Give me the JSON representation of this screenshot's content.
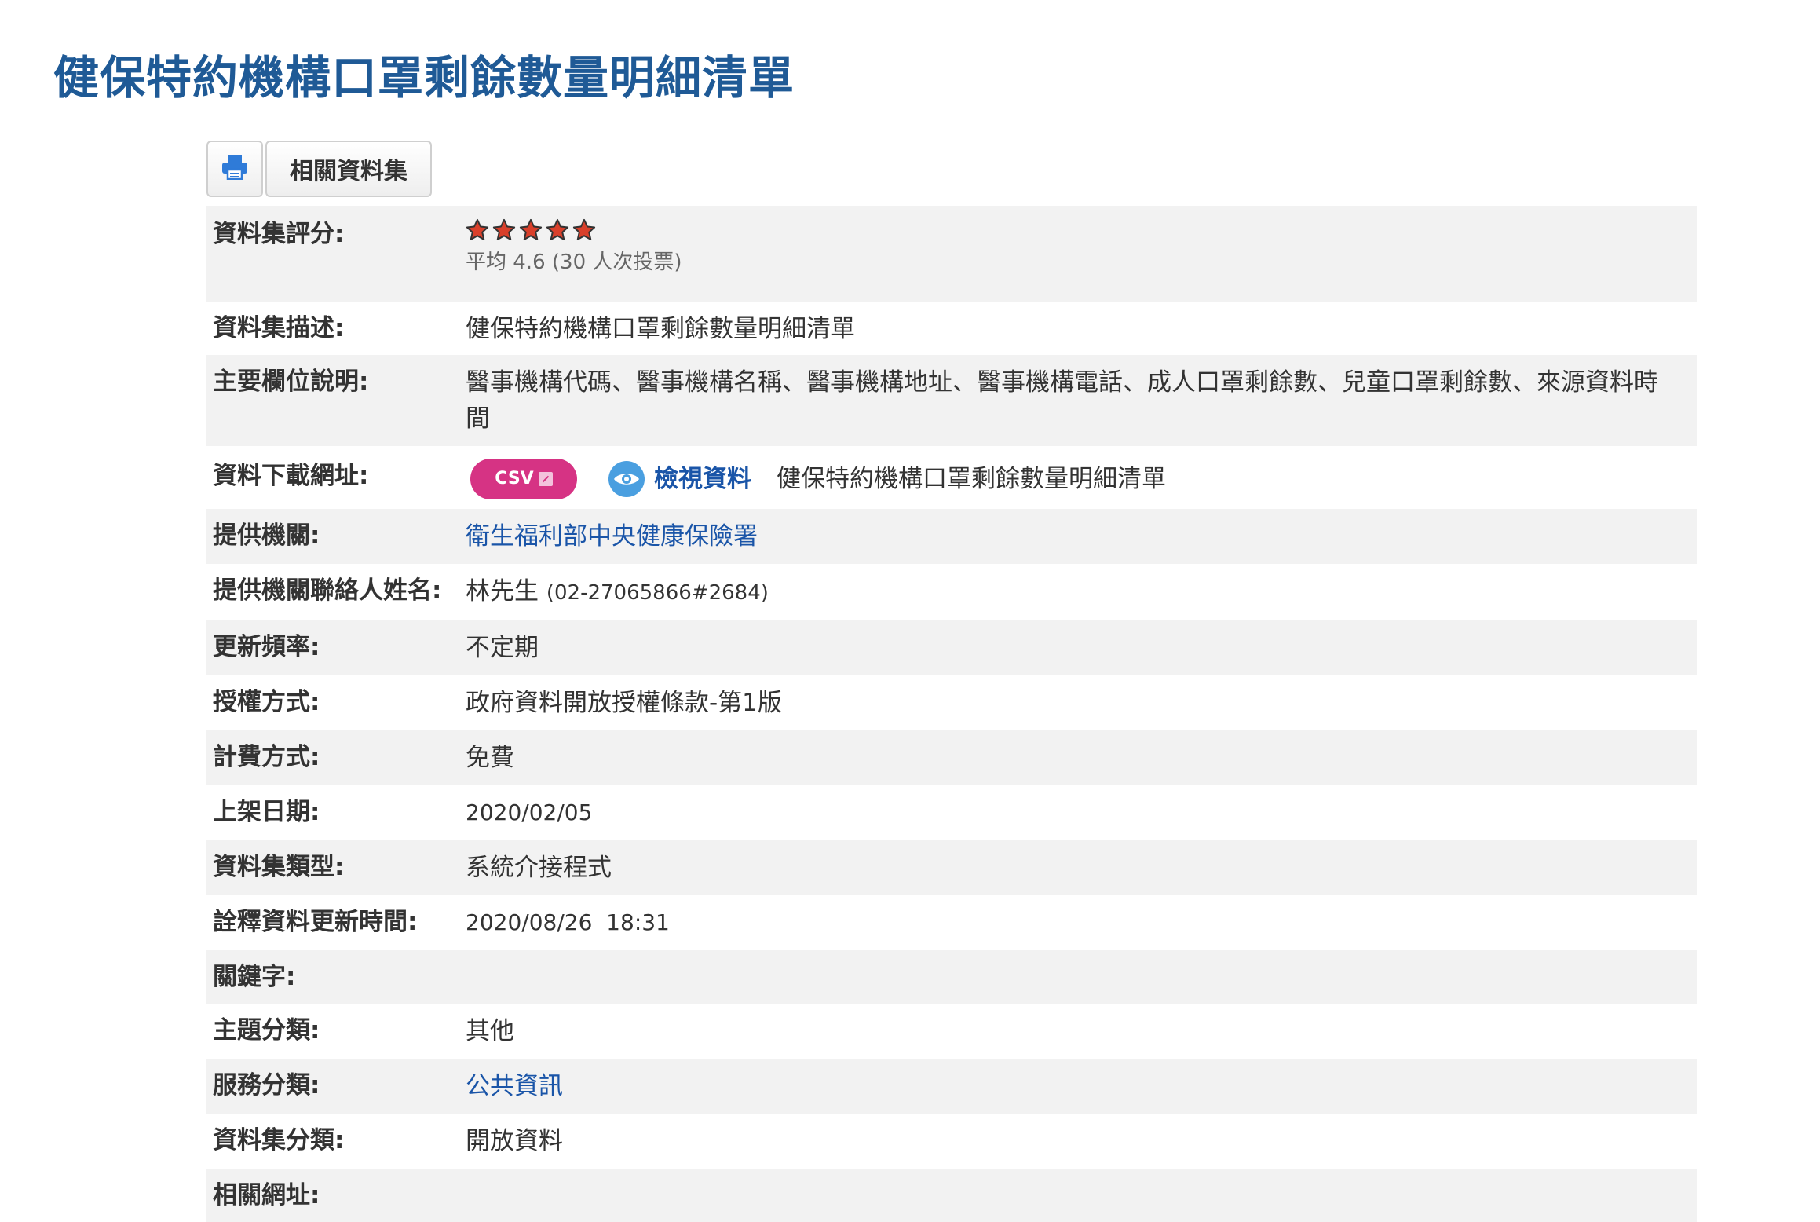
{
  "page": {
    "title": "健保特約機構口罩剩餘數量明細清單"
  },
  "toolbar": {
    "print_icon": "printer-icon",
    "related_label": "相關資料集"
  },
  "colors": {
    "title": "#1f5a96",
    "link": "#1a55a8",
    "csv_badge": "#d63384",
    "eye_icon": "#4a9fe0",
    "star": "#d9402b",
    "row_shade": "#f2f2f2"
  },
  "rating": {
    "label": "資料集評分:",
    "stars": 5,
    "average_text": "平均 4.6 (30 人次投票)"
  },
  "description": {
    "label": "資料集描述:",
    "value": "健保特約機構口罩剩餘數量明細清單"
  },
  "fields": {
    "label": "主要欄位說明:",
    "value": "醫事機構代碼、醫事機構名稱、醫事機構地址、醫事機構電話、成人口罩剩餘數、兒童口罩剩餘數、來源資料時間"
  },
  "download": {
    "label": "資料下載網址:",
    "csv_label": "CSV",
    "view_label": "檢視資料",
    "name": "健保特約機構口罩剩餘數量明細清單"
  },
  "provider": {
    "label": "提供機關:",
    "value": "衛生福利部中央健康保險署"
  },
  "contact": {
    "label": "提供機關聯絡人姓名:",
    "name": "林先生",
    "phone": "(02-27065866#2684)"
  },
  "frequency": {
    "label": "更新頻率:",
    "value": "不定期"
  },
  "license": {
    "label": "授權方式:",
    "value": "政府資料開放授權條款-第1版"
  },
  "fee": {
    "label": "計費方式:",
    "value": "免費"
  },
  "published": {
    "label": "上架日期:",
    "value": "2020/02/05"
  },
  "dataset_type": {
    "label": "資料集類型:",
    "value": "系統介接程式"
  },
  "metadata_updated": {
    "label": "詮釋資料更新時間:",
    "value": "2020/08/26  18:31"
  },
  "keywords": {
    "label": "關鍵字:",
    "value": ""
  },
  "topic": {
    "label": "主題分類:",
    "value": "其他"
  },
  "service": {
    "label": "服務分類:",
    "value": "公共資訊"
  },
  "category": {
    "label": "資料集分類:",
    "value": "開放資料"
  },
  "related_url": {
    "label": "相關網址:",
    "value": ""
  }
}
